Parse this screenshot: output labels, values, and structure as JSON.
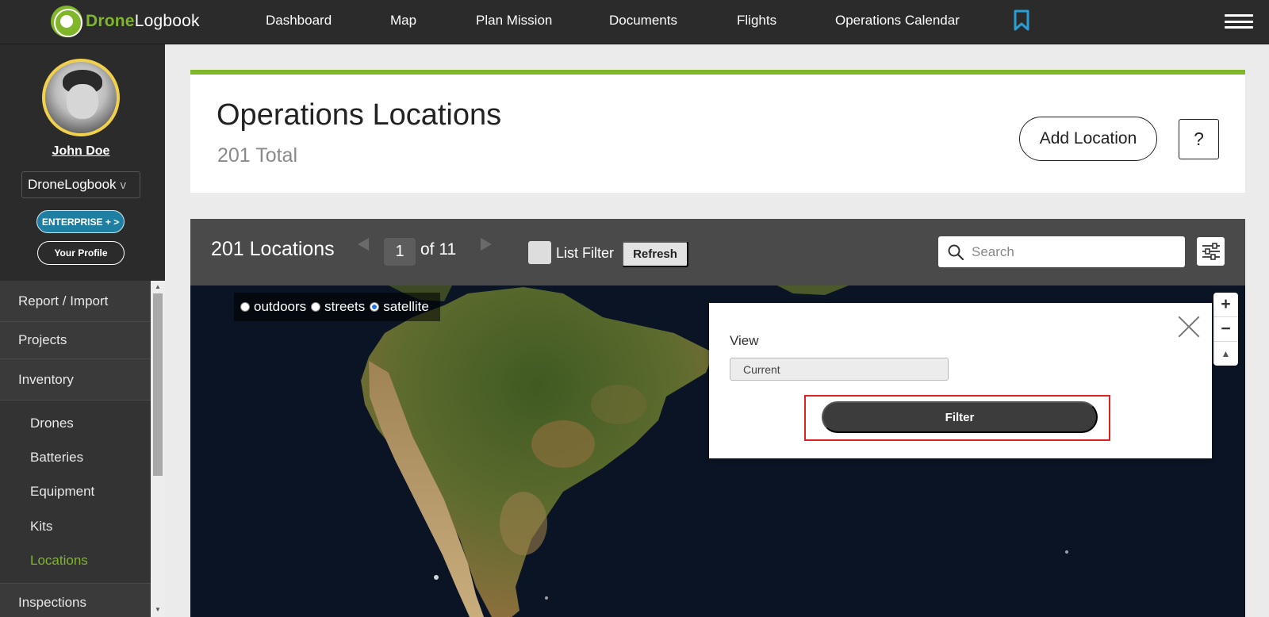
{
  "brand": {
    "part1": "Drone",
    "part2": "Logbook"
  },
  "nav": {
    "items": [
      "Dashboard",
      "Map",
      "Plan Mission",
      "Documents",
      "Flights",
      "Operations Calendar"
    ]
  },
  "sidebar": {
    "user_name": "John Doe",
    "org": "DroneLogbook",
    "org_chevron": "v",
    "enterprise_label": "ENTERPRISE + >",
    "profile_label": "Your Profile",
    "menu": [
      "Report / Import",
      "Projects",
      "Inventory"
    ],
    "inventory_sub": [
      "Drones",
      "Batteries",
      "Equipment",
      "Kits",
      "Locations"
    ],
    "active_sub": "Locations",
    "after_menu": [
      "Inspections"
    ]
  },
  "header": {
    "title": "Operations Locations",
    "total": "201 Total",
    "add_label": "Add Location",
    "help_label": "?"
  },
  "toolbar": {
    "count": "201 Locations",
    "page": "1",
    "of": "of 11",
    "list_filter_label": "List Filter",
    "refresh_label": "Refresh",
    "search_placeholder": "Search"
  },
  "map": {
    "layers": [
      "outdoors",
      "streets",
      "satellite"
    ],
    "selected_layer": "satellite",
    "zoom_in": "+",
    "zoom_out": "−",
    "compass": "▲"
  },
  "filter_popup": {
    "view_label": "View",
    "view_value": "Current",
    "filter_label": "Filter"
  },
  "colors": {
    "accent": "#7fb62a",
    "nav_bg": "#2b2b2b",
    "enterprise": "#1f7fa3",
    "highlight": "#e02020"
  }
}
